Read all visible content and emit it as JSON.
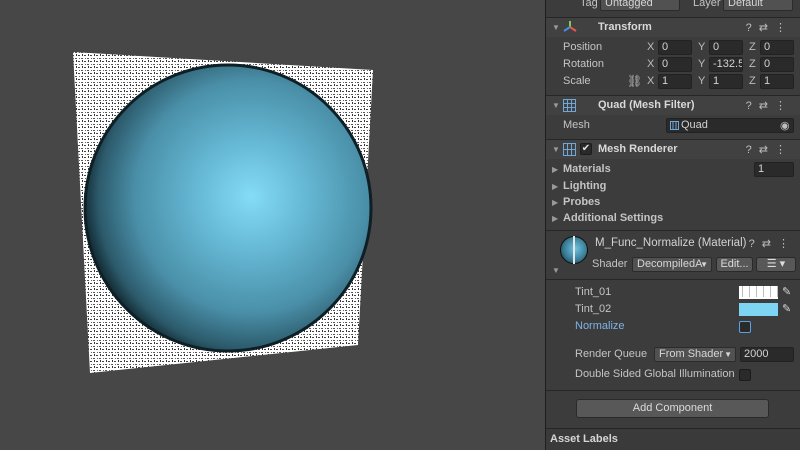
{
  "top": {
    "tag_label": "Tag",
    "tag_value": "Untagged",
    "layer_label": "Layer",
    "layer_value": "Default"
  },
  "transform": {
    "title": "Transform",
    "position": {
      "label": "Position",
      "x": "0",
      "y": "0",
      "z": "0"
    },
    "rotation": {
      "label": "Rotation",
      "x": "0",
      "y": "-132.5",
      "z": "0"
    },
    "scale": {
      "label": "Scale",
      "x": "1",
      "y": "1",
      "z": "1"
    },
    "axis_x": "X",
    "axis_y": "Y",
    "axis_z": "Z"
  },
  "mesh_filter": {
    "title": "Quad (Mesh Filter)",
    "mesh_label": "Mesh",
    "mesh_value": "Quad"
  },
  "mesh_renderer": {
    "title": "Mesh Renderer",
    "materials_label": "Materials",
    "materials_count": "1",
    "lighting": "Lighting",
    "probes": "Probes",
    "additional": "Additional Settings"
  },
  "material": {
    "title": "M_Func_Normalize (Material)",
    "shader_label": "Shader",
    "shader_value": "DecompiledA",
    "edit_label": "Edit...",
    "tint01_label": "Tint_01",
    "tint02_label": "Tint_02",
    "normalize_label": "Normalize",
    "render_queue_label": "Render Queue",
    "render_queue_mode": "From Shader",
    "render_queue_value": "2000",
    "dsgi_label": "Double Sided Global Illumination"
  },
  "add_component": "Add Component",
  "asset_labels": "Asset Labels",
  "colors": {
    "tint02": "#7ed4f3",
    "sphere_center": "#7fd7f2",
    "sphere_mid": "#4a90a8",
    "sphere_edge": "#1f3d4a",
    "normalize_blue": "#7fb3e8"
  }
}
